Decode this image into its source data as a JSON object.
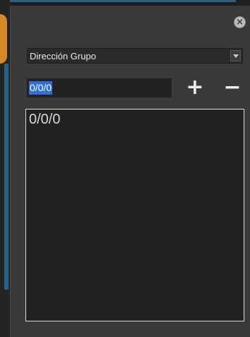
{
  "panel": {
    "close_icon": "close-icon",
    "address_type": {
      "selected": "Dirección Grupo"
    },
    "address_input": {
      "value": "0/0/0"
    },
    "add_label": "+",
    "remove_label": "−",
    "addresses": [
      "0/0/0"
    ]
  },
  "colors": {
    "panel_bg": "#3a3a3a",
    "list_bg": "#222222",
    "selection": "#2f6fd6",
    "list_border": "#d9d9d9"
  }
}
